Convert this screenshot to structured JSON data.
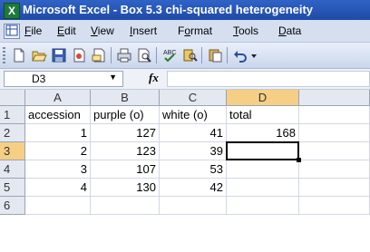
{
  "window": {
    "app_icon_letter": "X",
    "title": "Microsoft Excel - Box 5.3 chi-squared heterogeneity"
  },
  "menu": {
    "items": [
      {
        "label": "File",
        "key": "F",
        "rest": "ile"
      },
      {
        "label": "Edit",
        "key": "E",
        "rest": "dit"
      },
      {
        "label": "View",
        "key": "V",
        "rest": "iew"
      },
      {
        "label": "Insert",
        "key": "I",
        "rest": "nsert"
      },
      {
        "label": "Format",
        "key": "o",
        "pre": "F",
        "rest": "rmat"
      },
      {
        "label": "Tools",
        "key": "T",
        "rest": "ools"
      },
      {
        "label": "Data",
        "key": "D",
        "rest": "ata"
      }
    ]
  },
  "toolbar": {
    "icons": [
      "new-icon",
      "open-icon",
      "save-icon",
      "permission-icon",
      "email-icon",
      "print-icon",
      "print-preview-icon",
      "spelling-icon",
      "research-icon",
      "paste-icon",
      "undo-icon",
      "undo-dropdown-icon"
    ]
  },
  "formula_bar": {
    "name_box": "D3",
    "fx_label": "fx",
    "formula": ""
  },
  "sheet": {
    "columns": [
      "A",
      "B",
      "C",
      "D"
    ],
    "rows": [
      "1",
      "2",
      "3",
      "4",
      "5",
      "6"
    ],
    "cells": [
      [
        "accession",
        "purple (o)",
        "white (o)",
        "total"
      ],
      [
        "1",
        "127",
        "41",
        "168"
      ],
      [
        "2",
        "123",
        "39",
        ""
      ],
      [
        "3",
        "107",
        "53",
        ""
      ],
      [
        "4",
        "130",
        "42",
        ""
      ],
      [
        "",
        "",
        "",
        ""
      ]
    ],
    "selected_cell": "D3",
    "selected_column": "D",
    "selected_row": "3"
  },
  "colors": {
    "titlebar": "#2f63c5",
    "header_bg": "#e4e8f0",
    "header_selected": "#f5cf84",
    "gridline": "#d0d7e5"
  }
}
